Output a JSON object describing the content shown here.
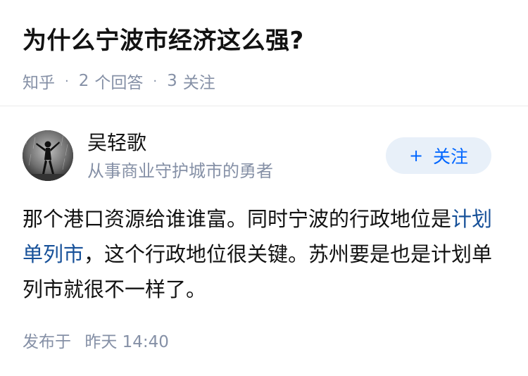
{
  "question": {
    "title": "为什么宁波市经济这么强?",
    "source": "知乎",
    "answer_count": "2",
    "answer_label": "个回答",
    "follower_count": "3",
    "follower_label": "关注",
    "separator": "·"
  },
  "answer": {
    "author": {
      "name": "吴轻歌",
      "headline": "从事商业守护城市的勇者",
      "avatar_icon": "avatar-person-icon"
    },
    "follow_button": {
      "icon": "plus-icon",
      "icon_glyph": "+",
      "label": "关注"
    },
    "content": {
      "text_before": "那个港口资源给谁谁富。同时宁波的行政地位是",
      "link_text": "计划单列市",
      "text_after": "，这个行政地位很关键。苏州要是也是计划单列市就很不一样了。"
    },
    "footer": {
      "published_label": "发布于",
      "published_time": "昨天 14:40"
    }
  },
  "colors": {
    "title": "#121212",
    "meta": "#8590a6",
    "link": "#175199",
    "follow_bg": "#e8f0f9",
    "follow_text": "#0066ff"
  }
}
